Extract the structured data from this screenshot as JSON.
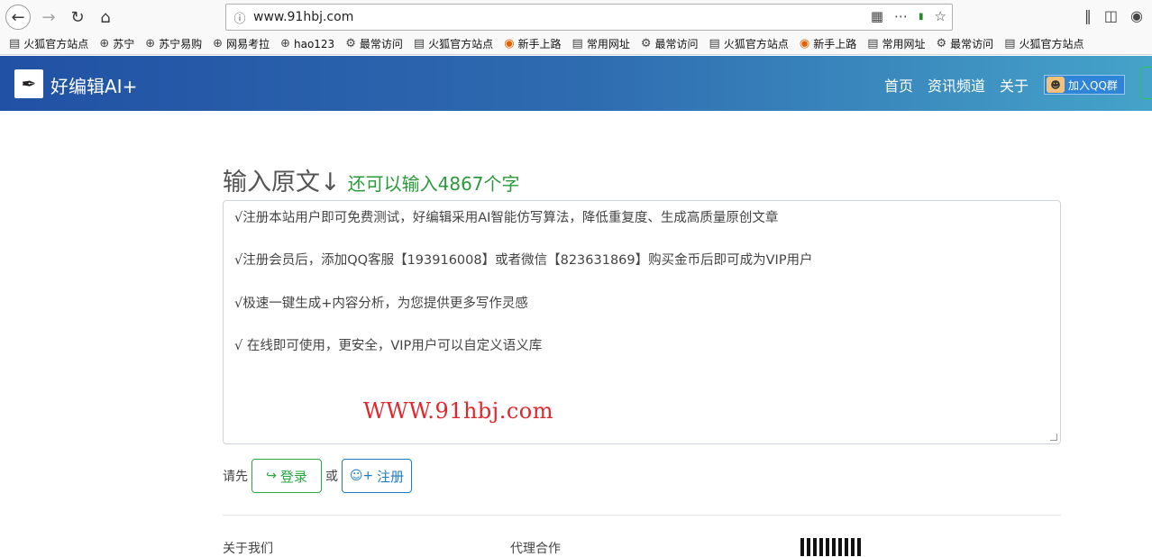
{
  "browser": {
    "url": "www.91hbj.com",
    "icons": {
      "back": "arrow-left-icon",
      "forward": "arrow-right-icon",
      "reload": "reload-icon",
      "home": "home-icon"
    }
  },
  "bookmarks": [
    {
      "label": "火狐官方站点",
      "icon": "folder"
    },
    {
      "label": "苏宁",
      "icon": "globe"
    },
    {
      "label": "苏宁易购",
      "icon": "globe"
    },
    {
      "label": "网易考拉",
      "icon": "globe"
    },
    {
      "label": "hao123",
      "icon": "globe"
    },
    {
      "label": "最常访问",
      "icon": "gear"
    },
    {
      "label": "火狐官方站点",
      "icon": "folder"
    },
    {
      "label": "新手上路",
      "icon": "firefox"
    },
    {
      "label": "常用网址",
      "icon": "folder"
    },
    {
      "label": "最常访问",
      "icon": "gear"
    },
    {
      "label": "火狐官方站点",
      "icon": "folder"
    },
    {
      "label": "新手上路",
      "icon": "firefox"
    },
    {
      "label": "常用网址",
      "icon": "folder"
    },
    {
      "label": "最常访问",
      "icon": "gear"
    },
    {
      "label": "火狐官方站点",
      "icon": "folder"
    }
  ],
  "site": {
    "brand": "好编辑AI+",
    "nav": [
      "首页",
      "资讯频道",
      "关于"
    ],
    "qq_button": "加入QQ群"
  },
  "main": {
    "heading": "输入原文↓",
    "remaining": "还可以输入4867个字",
    "editor_lines": [
      "√注册本站用户即可免费测试，好编辑采用AI智能仿写算法，降低重复度、生成高质量原创文章",
      "√注册会员后，添加QQ客服【193916008】或者微信【823631869】购买金币后即可成为VIP用户",
      "√极速一键生成+内容分析，为您提供更多写作灵感",
      "√ 在线即可使用，更安全，VIP用户可以自定义语义库"
    ],
    "watermark": "WWW.91hbj.com",
    "auth_prefix": "请先",
    "login_label": "登录",
    "or_label": "或",
    "register_label": "注册"
  },
  "footer": {
    "about": "关于我们",
    "partner": "代理合作"
  },
  "colors": {
    "header_start": "#2151a4",
    "header_end": "#45a3c9",
    "green": "#28a745",
    "blue": "#1e7bc4",
    "watermark": "#e3262c"
  }
}
